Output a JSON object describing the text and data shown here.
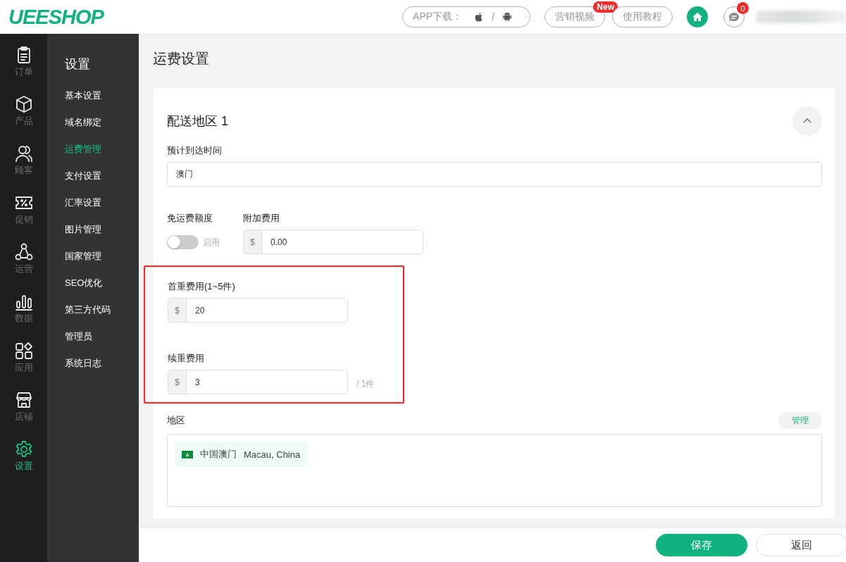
{
  "header": {
    "logo": "UEESHOP",
    "app_download": {
      "label": "APP下载：",
      "separator": "/"
    },
    "buttons": [
      {
        "label": "营销视频",
        "badge": "New"
      },
      {
        "label": "使用教程"
      }
    ],
    "messages_count": "0"
  },
  "rail": [
    {
      "label": "订单",
      "kind": "clipboard",
      "selected": false
    },
    {
      "label": "产品",
      "kind": "box",
      "selected": false
    },
    {
      "label": "顾客",
      "kind": "people",
      "selected": false
    },
    {
      "label": "促销",
      "kind": "ticket",
      "selected": false
    },
    {
      "label": "运营",
      "kind": "nodes",
      "selected": false
    },
    {
      "label": "数据",
      "kind": "bars",
      "selected": false
    },
    {
      "label": "应用",
      "kind": "apps",
      "selected": false
    },
    {
      "label": "店铺",
      "kind": "store",
      "selected": false
    },
    {
      "label": "设置",
      "kind": "gear",
      "selected": true
    }
  ],
  "submenu": {
    "title": "设置",
    "items": [
      {
        "label": "基本设置",
        "selected": false
      },
      {
        "label": "域名绑定",
        "selected": false
      },
      {
        "label": "运费管理",
        "selected": true
      },
      {
        "label": "支付设置",
        "selected": false
      },
      {
        "label": "汇率设置",
        "selected": false
      },
      {
        "label": "图片管理",
        "selected": false
      },
      {
        "label": "国家管理",
        "selected": false
      },
      {
        "label": "SEO优化",
        "selected": false
      },
      {
        "label": "第三方代码",
        "selected": false
      },
      {
        "label": "管理员",
        "selected": false
      },
      {
        "label": "系统日志",
        "selected": false
      }
    ]
  },
  "page_title": "运费设置",
  "zone": {
    "title": "配送地区 1",
    "expanded": true,
    "eta_label": "预计到达时间",
    "eta_value": "澳门",
    "free_shipping": {
      "label": "免运费额度",
      "on": false,
      "toggle_label": "启用"
    },
    "extra_fee": {
      "label": "附加费用",
      "currency": "$",
      "value": "0.00"
    },
    "first_weight": {
      "label": "首重费用(1~5件)",
      "currency": "$",
      "value": "20"
    },
    "additional_weight": {
      "label": "续重费用",
      "currency": "$",
      "value": "3",
      "unit": "/ 1件"
    },
    "region": {
      "label": "地区",
      "manage": "管理",
      "tags": [
        {
          "name": "中国澳门",
          "english": "Macau, China"
        }
      ]
    }
  },
  "footer": {
    "save": "保存",
    "back": "返回"
  }
}
